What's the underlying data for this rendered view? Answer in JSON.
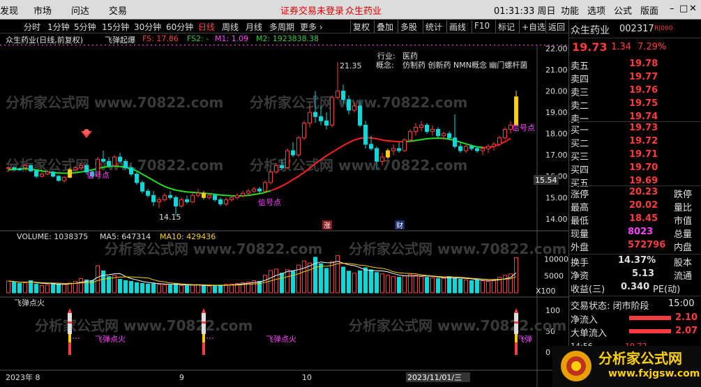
{
  "menu": {
    "items": [
      "发现",
      "市场",
      "问达",
      "交易"
    ],
    "alert": "证券交易未登录",
    "stock": "众生药业",
    "time": "01:31:33 周日",
    "right": [
      "功能",
      "选项",
      "公式",
      "版面"
    ],
    "win_ctl": [
      "–",
      "□",
      "✕"
    ]
  },
  "periods": [
    "分时",
    "1分钟",
    "5分钟",
    "15分钟",
    "30分钟",
    "60分钟",
    "日线",
    "周线",
    "月线",
    "多周期",
    "更多 ›"
  ],
  "active_period": "日线",
  "toolbar": [
    "复权",
    "叠加",
    "多股",
    "统计",
    "画线",
    "F10",
    "标记",
    "+自选",
    "返回"
  ],
  "info": {
    "name": "众生药业(日线,前复权)",
    "formula": "飞弹起爆",
    "fs_label": "FS: 17.86",
    "fs2_label": "FS2: -",
    "m1_label": "M1: 1.09",
    "m2_label": "M2: 1923838.38"
  },
  "annot": {
    "industry_k": "行业:",
    "industry_v": "医药",
    "concept_k": "概念:",
    "concept_v": "仿制药 创新药 NMN概念 幽门螺杆菌",
    "high": "21.35",
    "low": "14.15",
    "sig": "信号点",
    "sig3": "信号点",
    "sig4": "信号点",
    "zhang": "涨",
    "cai": "财",
    "price_tag": "15.54"
  },
  "volume_info": {
    "label": "VOLUME: 1038375",
    "ma5": "MA5: 647314",
    "ma10": "MA10: 429436"
  },
  "ind_info": {
    "label": "飞弹点火",
    "fire": "飞弹点火",
    "fire3": "飞弹"
  },
  "date_labels": [
    "2023年 8",
    "9",
    "10",
    "2023/11/01/三"
  ],
  "right_panel": {
    "name": "众生药业",
    "code": "002317",
    "badge": "R|000",
    "price": "19.73",
    "chg": "1.34",
    "pct": "7.29%",
    "sell": [
      {
        "l": "卖五",
        "p": "19.78"
      },
      {
        "l": "卖四",
        "p": "19.77"
      },
      {
        "l": "卖三",
        "p": "19.76"
      },
      {
        "l": "卖二",
        "p": "19.75"
      },
      {
        "l": "卖一",
        "p": "19.74"
      }
    ],
    "buy": [
      {
        "l": "买一",
        "p": "19.73"
      },
      {
        "l": "买二",
        "p": "19.72"
      },
      {
        "l": "买三",
        "p": "19.71"
      },
      {
        "l": "买四",
        "p": "19.70"
      },
      {
        "l": "买五",
        "p": "19.69"
      }
    ],
    "stats": [
      {
        "k": "涨停",
        "v": "20.23",
        "k2": "跌停"
      },
      {
        "k": "最高",
        "v": "20.02",
        "k2": "量比"
      },
      {
        "k": "最低",
        "v": "18.45",
        "k2": "市值"
      },
      {
        "k": "现量",
        "v": "8023",
        "k2": "总量"
      },
      {
        "k": "外盘",
        "v": "572796",
        "k2": "内盘"
      }
    ],
    "stats2": [
      {
        "k": "换手",
        "v": "14.37%",
        "k2": "股本"
      },
      {
        "k": "净资",
        "v": "5.13",
        "k2": "流通"
      },
      {
        "k": "收益(三)",
        "v": "0.340",
        "k2": "PE(动)"
      }
    ],
    "trade_state": "交易状态: 闭市阶段",
    "trade_time": "15:00",
    "flow": [
      {
        "k": "净流入",
        "v": "2.10"
      },
      {
        "k": "大单流入",
        "v": "2.07"
      }
    ],
    "last": {
      "t": "14:56",
      "p": "19.72"
    }
  },
  "watermark": {
    "text": "分析家公式网 www.70822.com",
    "logo": "分析家公式网",
    "url": "www.fxjgsw.com"
  },
  "chart_data": {
    "type": "candlestick",
    "y_ticks": [
      "22.00",
      "21.00",
      "20.00",
      "19.00",
      "18.00",
      "17.00",
      "16.00",
      "15.00",
      "14.00"
    ],
    "vol_ticks": [
      "10000",
      "5000"
    ],
    "vol_unit": "X100",
    "ind_ticks": [
      "100",
      "50",
      "0"
    ],
    "candles": [
      [
        16.4,
        16.5,
        16.2,
        16.4
      ],
      [
        16.4,
        16.5,
        16.3,
        16.35
      ],
      [
        16.35,
        16.4,
        16.25,
        16.3
      ],
      [
        16.4,
        16.6,
        16.3,
        16.5
      ],
      [
        16.5,
        16.55,
        16.2,
        16.25
      ],
      [
        16.25,
        16.3,
        15.9,
        16.0
      ],
      [
        16.0,
        16.2,
        15.95,
        16.1
      ],
      [
        16.1,
        16.3,
        16.05,
        16.2
      ],
      [
        16.2,
        16.25,
        15.95,
        16.0
      ],
      [
        16.0,
        16.05,
        15.75,
        15.8
      ],
      [
        15.8,
        16.0,
        15.7,
        15.95
      ],
      [
        15.95,
        16.4,
        15.9,
        16.3
      ],
      [
        16.3,
        16.5,
        16.2,
        16.4
      ],
      [
        16.4,
        16.6,
        16.3,
        16.5
      ],
      [
        16.5,
        16.6,
        16.1,
        16.2
      ],
      [
        16.2,
        16.3,
        15.9,
        16.0
      ],
      [
        16.0,
        16.9,
        16.0,
        16.8
      ],
      [
        16.8,
        17.2,
        16.6,
        16.7
      ],
      [
        16.7,
        16.9,
        16.4,
        16.5
      ],
      [
        16.5,
        17.0,
        16.45,
        16.9
      ],
      [
        16.9,
        17.1,
        16.6,
        16.7
      ],
      [
        16.7,
        16.8,
        16.3,
        16.4
      ],
      [
        16.4,
        16.5,
        16.0,
        16.1
      ],
      [
        16.1,
        16.2,
        15.6,
        15.7
      ],
      [
        15.7,
        15.8,
        15.2,
        15.3
      ],
      [
        15.3,
        15.4,
        15.0,
        15.1
      ],
      [
        15.1,
        15.3,
        14.6,
        14.8
      ],
      [
        14.8,
        15.0,
        14.5,
        14.9
      ],
      [
        14.9,
        15.2,
        14.8,
        15.1
      ],
      [
        15.1,
        15.3,
        14.9,
        15.0
      ],
      [
        15.0,
        15.1,
        14.15,
        14.6
      ],
      [
        14.6,
        15.0,
        14.5,
        14.9
      ],
      [
        14.9,
        15.1,
        14.7,
        14.8
      ],
      [
        14.8,
        15.2,
        14.75,
        15.1
      ],
      [
        15.1,
        15.4,
        15.0,
        15.2
      ],
      [
        15.2,
        15.3,
        14.9,
        15.0
      ],
      [
        15.0,
        15.2,
        14.9,
        15.1
      ],
      [
        15.1,
        15.2,
        14.8,
        14.9
      ],
      [
        14.9,
        15.0,
        14.6,
        14.7
      ],
      [
        14.7,
        15.0,
        14.6,
        14.9
      ],
      [
        14.9,
        15.1,
        14.8,
        15.0
      ],
      [
        15.0,
        15.2,
        14.9,
        15.1
      ],
      [
        15.1,
        15.3,
        15.0,
        15.2
      ],
      [
        15.2,
        15.4,
        15.1,
        15.3
      ],
      [
        15.3,
        15.5,
        15.2,
        15.4
      ],
      [
        15.4,
        15.5,
        15.2,
        15.3
      ],
      [
        15.3,
        15.8,
        15.25,
        15.7
      ],
      [
        15.7,
        16.3,
        15.6,
        16.2
      ],
      [
        16.2,
        16.6,
        16.1,
        16.5
      ],
      [
        16.5,
        16.8,
        16.3,
        16.4
      ],
      [
        16.4,
        17.3,
        16.35,
        17.2
      ],
      [
        17.2,
        17.6,
        16.9,
        17.0
      ],
      [
        17.0,
        17.9,
        16.9,
        17.8
      ],
      [
        17.8,
        18.6,
        17.7,
        18.5
      ],
      [
        18.5,
        19.3,
        18.3,
        19.0
      ],
      [
        19.0,
        20.0,
        18.5,
        18.8
      ],
      [
        18.8,
        19.3,
        18.4,
        18.6
      ],
      [
        18.6,
        19.0,
        18.2,
        18.4
      ],
      [
        18.4,
        19.8,
        18.3,
        19.7
      ],
      [
        19.7,
        21.35,
        19.6,
        20.0
      ],
      [
        20.0,
        20.3,
        19.4,
        19.6
      ],
      [
        19.6,
        19.8,
        18.9,
        19.1
      ],
      [
        19.1,
        19.5,
        19.0,
        19.3
      ],
      [
        19.3,
        19.6,
        18.3,
        18.4
      ],
      [
        18.4,
        18.6,
        17.3,
        17.5
      ],
      [
        17.5,
        17.9,
        17.2,
        17.3
      ],
      [
        17.3,
        17.4,
        16.3,
        16.7
      ],
      [
        16.7,
        17.1,
        16.5,
        16.9
      ],
      [
        16.9,
        17.3,
        16.8,
        17.2
      ],
      [
        17.2,
        17.5,
        17.0,
        17.3
      ],
      [
        17.3,
        17.6,
        17.1,
        17.2
      ],
      [
        17.2,
        17.8,
        17.15,
        17.7
      ],
      [
        17.7,
        18.2,
        17.6,
        18.1
      ],
      [
        18.1,
        18.5,
        17.9,
        18.3
      ],
      [
        18.3,
        18.6,
        18.1,
        18.4
      ],
      [
        18.4,
        18.5,
        18.0,
        18.1
      ],
      [
        18.1,
        18.4,
        17.9,
        18.2
      ],
      [
        18.2,
        18.3,
        17.8,
        17.9
      ],
      [
        17.9,
        18.1,
        17.7,
        18.0
      ],
      [
        18.0,
        18.1,
        17.7,
        17.8
      ],
      [
        17.8,
        18.9,
        17.3,
        17.4
      ],
      [
        17.4,
        17.6,
        17.1,
        17.2
      ],
      [
        17.2,
        17.5,
        17.1,
        17.4
      ],
      [
        17.4,
        17.5,
        17.2,
        17.3
      ],
      [
        17.3,
        17.4,
        17.1,
        17.2
      ],
      [
        17.2,
        17.4,
        17.0,
        17.3
      ],
      [
        17.3,
        17.5,
        17.1,
        17.4
      ],
      [
        17.4,
        17.6,
        17.2,
        17.5
      ],
      [
        17.5,
        17.9,
        17.4,
        17.8
      ],
      [
        17.8,
        18.3,
        17.7,
        18.2
      ],
      [
        18.2,
        18.6,
        18.0,
        18.4
      ],
      [
        18.39,
        20.02,
        18.45,
        19.73
      ]
    ],
    "ma": [
      16.3,
      16.32,
      16.34,
      16.35,
      16.33,
      16.3,
      16.25,
      16.2,
      16.18,
      16.15,
      16.14,
      16.14,
      16.16,
      16.2,
      16.25,
      16.3,
      16.36,
      16.42,
      16.46,
      16.48,
      16.46,
      16.42,
      16.35,
      16.25,
      16.1,
      15.95,
      15.8,
      15.65,
      15.52,
      15.42,
      15.35,
      15.3,
      15.26,
      15.24,
      15.22,
      15.2,
      15.18,
      15.15,
      15.12,
      15.1,
      15.08,
      15.07,
      15.08,
      15.1,
      15.14,
      15.18,
      15.24,
      15.32,
      15.42,
      15.54,
      15.68,
      15.84,
      16.0,
      16.18,
      16.38,
      16.58,
      16.78,
      16.96,
      17.12,
      17.28,
      17.44,
      17.58,
      17.7,
      17.78,
      17.82,
      17.8,
      17.76,
      17.7,
      17.66,
      17.64,
      17.62,
      17.62,
      17.64,
      17.68,
      17.72,
      17.76,
      17.78,
      17.79,
      17.78,
      17.74,
      17.68,
      17.6,
      17.52,
      17.44,
      17.38,
      17.35,
      17.35,
      17.4,
      17.5,
      17.62,
      17.78
    ],
    "volume": [
      3500,
      3200,
      2800,
      3000,
      3600,
      2600,
      2200,
      2400,
      2800,
      2600,
      2500,
      2900,
      3400,
      4200,
      3800,
      3600,
      8000,
      6500,
      4800,
      5200,
      4000,
      3600,
      3400,
      3000,
      2800,
      2600,
      2700,
      2500,
      2400,
      2300,
      2600,
      2200,
      2100,
      2300,
      2400,
      2100,
      2000,
      2200,
      2300,
      2500,
      2600,
      2800,
      3000,
      3200,
      3600,
      3400,
      5200,
      6600,
      7000,
      5800,
      6800,
      6400,
      8200,
      9400,
      8800,
      10500,
      8600,
      7200,
      9200,
      11000,
      7600,
      6400,
      5800,
      6500,
      7400,
      6800,
      6000,
      5600,
      5200,
      4800,
      4600,
      5000,
      5400,
      5200,
      4800,
      4600,
      4400,
      4200,
      4300,
      4800,
      4400,
      4000,
      3800,
      3600,
      3800,
      3600,
      3400,
      3800,
      4600,
      5200,
      5600,
      10383
    ],
    "signals": [
      11,
      35,
      68,
      91
    ]
  }
}
